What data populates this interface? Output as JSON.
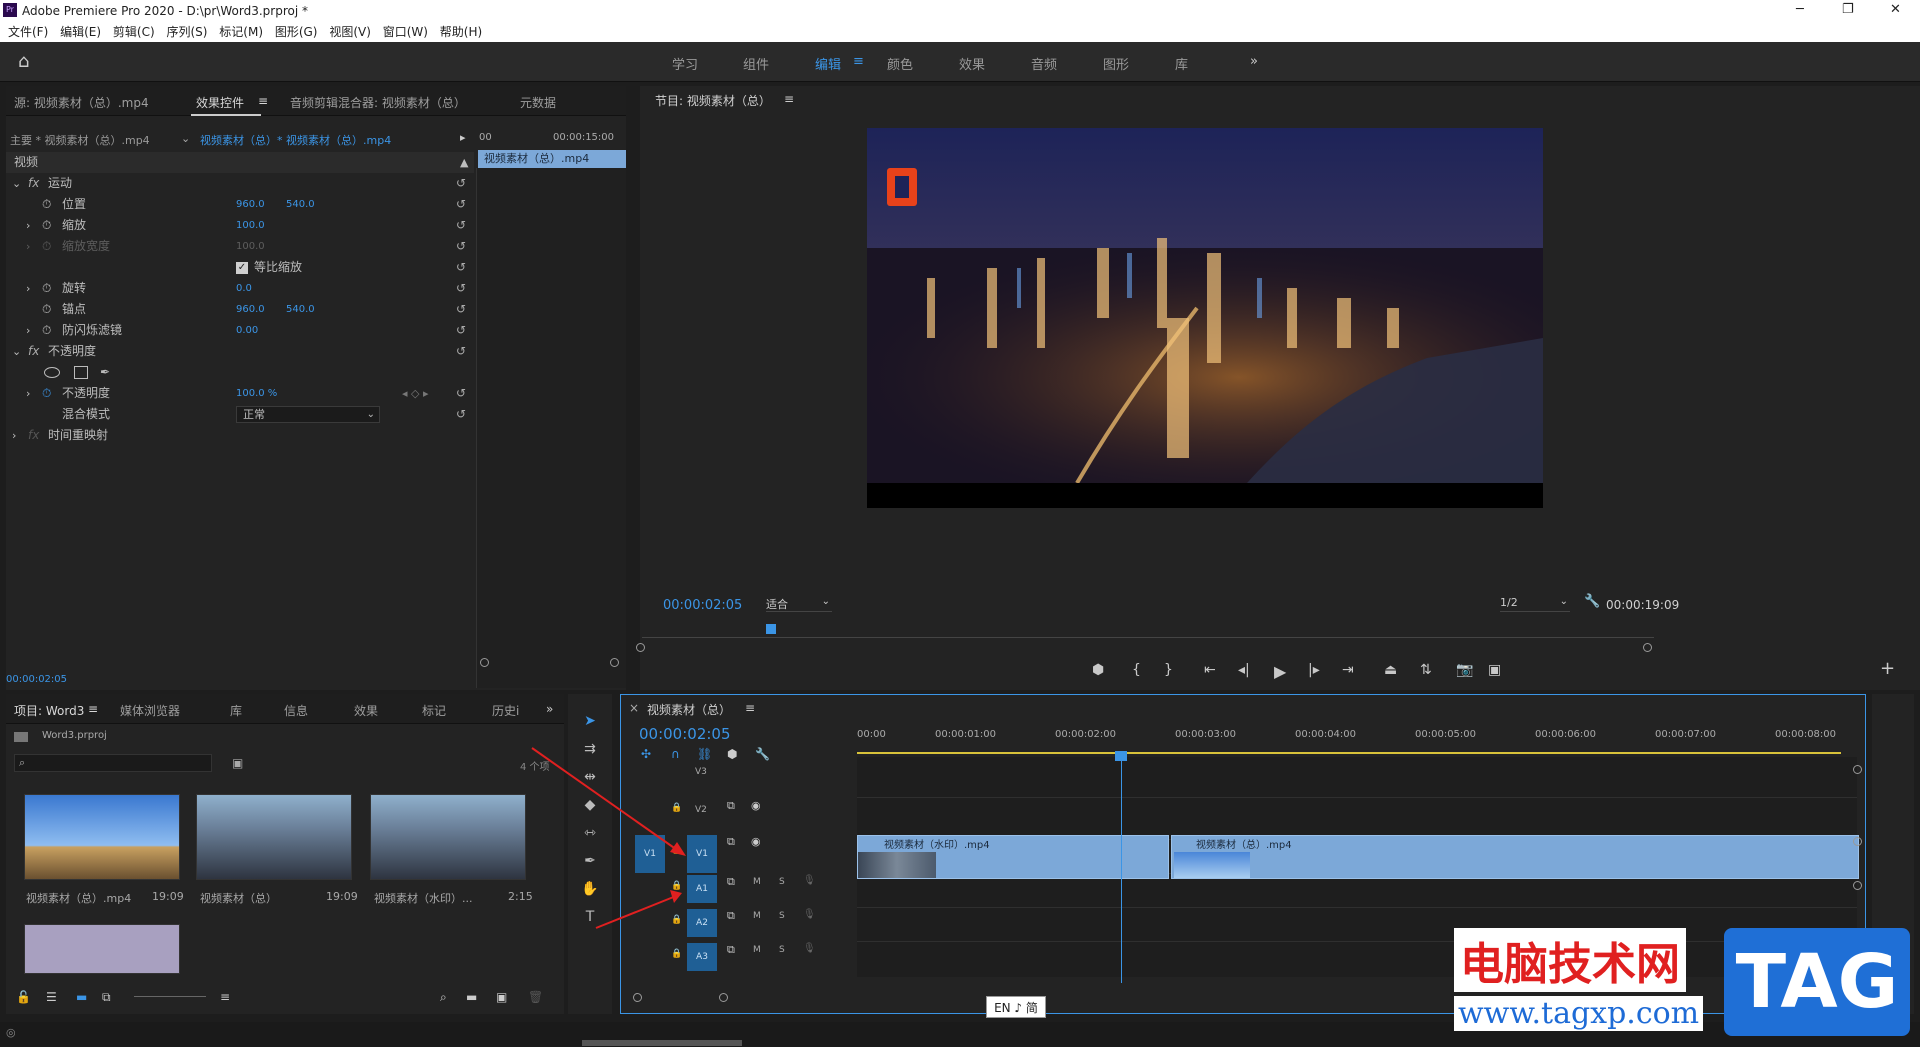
{
  "window": {
    "title": "Adobe Premiere Pro 2020 - D:\\pr\\Word3.prproj *",
    "minimize": "─",
    "maximize": "❐",
    "close": "✕"
  },
  "menu": [
    "文件(F)",
    "编辑(E)",
    "剪辑(C)",
    "序列(S)",
    "标记(M)",
    "图形(G)",
    "视图(V)",
    "窗口(W)",
    "帮助(H)"
  ],
  "workspaces": {
    "items": [
      "学习",
      "组件",
      "编辑",
      "颜色",
      "效果",
      "音频",
      "图形",
      "库"
    ],
    "active": "编辑",
    "more": "»",
    "menu_glyph": "≡"
  },
  "source_tabs": {
    "source": "源: 视频素材（总）.mp4",
    "effect_controls": "效果控件",
    "audio_mixer": "音频剪辑混合器: 视频素材（总）",
    "metadata": "元数据",
    "menu_glyph": "≡"
  },
  "effect_controls": {
    "master": "主要 * 视频素材（总）.mp4",
    "clip": "视频素材（总）* 视频素材（总）.mp4",
    "timecode_zero": "00",
    "timecode_end": "00:00:15:00",
    "mini_clip": "视频素材（总）.mp4",
    "video_header": "视频",
    "motion": "运动",
    "fx": "fx",
    "position_label": "位置",
    "position_x": "960.0",
    "position_y": "540.0",
    "scale_label": "缩放",
    "scale_value": "100.0",
    "scale_width_label": "缩放宽度",
    "scale_width_value": "100.0",
    "uniform_scale_label": "等比缩放",
    "rotation_label": "旋转",
    "rotation_value": "0.0",
    "anchor_label": "锚点",
    "anchor_x": "960.0",
    "anchor_y": "540.0",
    "flicker_label": "防闪烁滤镜",
    "flicker_value": "0.00",
    "opacity_group": "不透明度",
    "opacity_label": "不透明度",
    "opacity_value": "100.0 %",
    "blend_label": "混合模式",
    "blend_value": "正常",
    "time_remap": "时间重映射",
    "footer_timecode": "00:00:02:05"
  },
  "program": {
    "title": "节目: 视频素材（总）",
    "menu_glyph": "≡",
    "timecode": "00:00:02:05",
    "fit": "适合",
    "quality": "1/2",
    "duration": "00:00:19:09",
    "plus": "+"
  },
  "project": {
    "tabs": [
      "项目: Word3",
      "媒体浏览器",
      "库",
      "信息",
      "效果",
      "标记",
      "历史i"
    ],
    "more": "»",
    "file": "Word3.prproj",
    "count": "4 个项",
    "items": [
      {
        "name": "视频素材（总）.mp4",
        "duration": "19:09"
      },
      {
        "name": "视频素材（总）",
        "duration": "19:09"
      },
      {
        "name": "视频素材（水印）...",
        "duration": "2:15"
      }
    ]
  },
  "timeline": {
    "close": "×",
    "title": "视频素材（总）",
    "menu_glyph": "≡",
    "timecode": "00:00:02:05",
    "ruler": [
      "00:00",
      "00:00:01:00",
      "00:00:02:00",
      "00:00:03:00",
      "00:00:04:00",
      "00:00:05:00",
      "00:00:06:00",
      "00:00:07:00",
      "00:00:08:00"
    ],
    "tracks": {
      "v3": "V3",
      "v2": "V2",
      "v1": "V1",
      "a1": "A1",
      "a2": "A2",
      "a3": "A3",
      "source_v1": "V1",
      "m": "M",
      "s": "S"
    },
    "clip1": "视频素材（水印）.mp4",
    "clip2": "视频素材（总）.mp4"
  },
  "ime": "EN ♪ 简",
  "watermark": {
    "title": "电脑技术网",
    "url": "www.tagxp.com",
    "tag": "TAG"
  },
  "colors": {
    "accent": "#3b95e6",
    "clip": "#7ca8d8",
    "track_blue": "#1f5f95",
    "playhead": "#3b95e6"
  }
}
